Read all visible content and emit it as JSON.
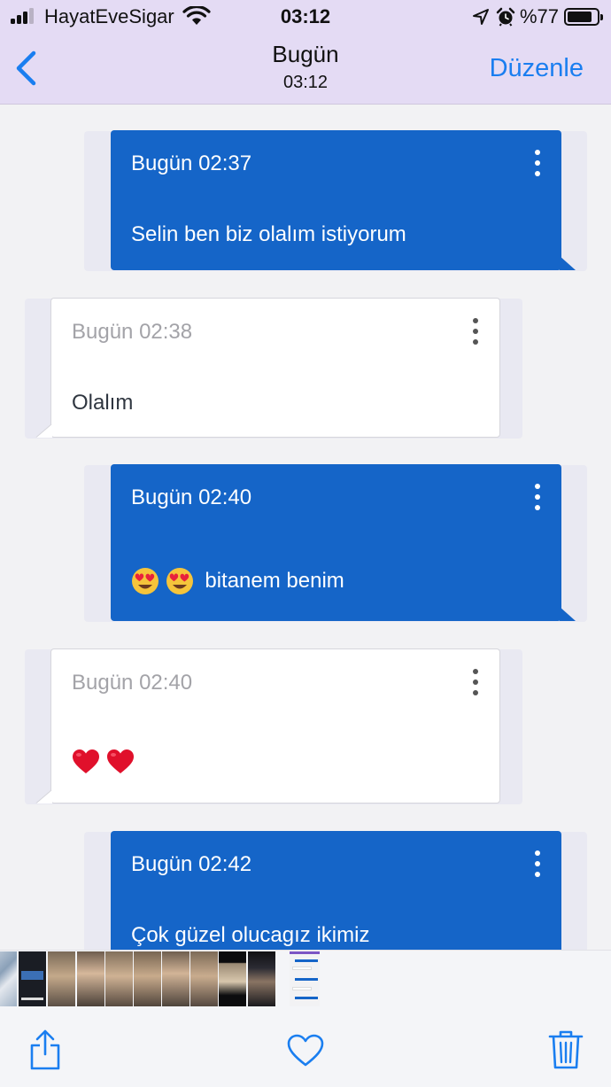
{
  "status_bar": {
    "carrier": "HayatEveSigar",
    "time": "03:12",
    "battery_percent": "%77",
    "battery_level": 0.77,
    "signal_bars": 3
  },
  "nav": {
    "title": "Bugün",
    "subtitle": "03:12",
    "edit_label": "Düzenle",
    "accent_color": "#1a7ef0"
  },
  "messages": [
    {
      "direction": "sent",
      "timestamp": "Bugün 02:37",
      "text": "Selin ben biz olalım istiyorum",
      "emoji": []
    },
    {
      "direction": "received",
      "timestamp": "Bugün 02:38",
      "text": "Olalım",
      "emoji": []
    },
    {
      "direction": "sent",
      "timestamp": "Bugün 02:40",
      "text": "bitanem benim",
      "emoji": [
        "heart-eyes-emoji",
        "heart-eyes-emoji"
      ]
    },
    {
      "direction": "received",
      "timestamp": "Bugün 02:40",
      "text": "",
      "emoji": [
        "red-heart-emoji",
        "red-heart-emoji"
      ]
    },
    {
      "direction": "sent",
      "timestamp": "Bugün 02:42",
      "text": "Çok güzel olucagız ikimiz",
      "emoji": []
    }
  ],
  "colors": {
    "sent_bubble": "#1565c8",
    "received_bubble": "#ffffff",
    "header_background": "#e4dbf4"
  },
  "thumbnails": [
    "thumb-photo",
    "thumb-dark-screen",
    "thumb-photo",
    "thumb-photo",
    "thumb-photo",
    "thumb-photo",
    "thumb-photo",
    "thumb-photo",
    "thumb-photo",
    "thumb-photo-portrait",
    "thumb-current-chat"
  ],
  "toolbar": {
    "icons": [
      "share-icon",
      "heart-icon",
      "trash-icon"
    ]
  }
}
